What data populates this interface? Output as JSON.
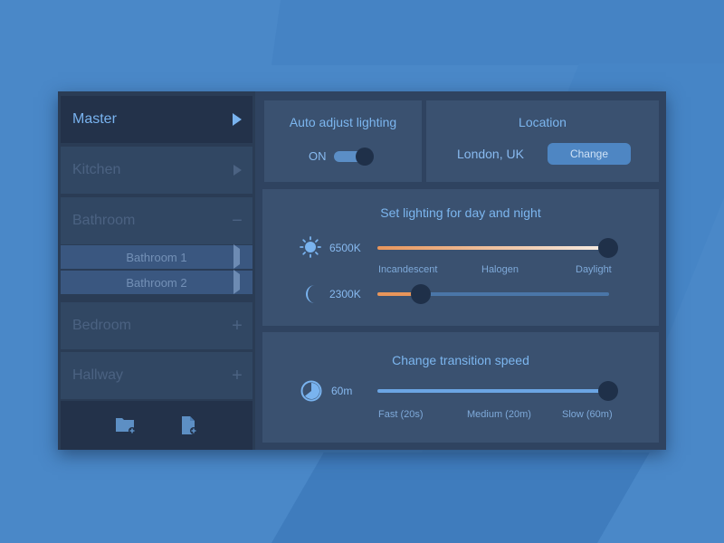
{
  "sidebar": {
    "items": [
      {
        "label": "Master"
      },
      {
        "label": "Kitchen"
      },
      {
        "label": "Bathroom"
      },
      {
        "label": "Bedroom"
      },
      {
        "label": "Hallway"
      }
    ],
    "subitems": [
      {
        "label": "Bathroom 1"
      },
      {
        "label": "Bathroom 2"
      }
    ],
    "footer_icons": [
      "folder-add-icon",
      "file-add-icon"
    ]
  },
  "auto_adjust": {
    "title": "Auto adjust lighting",
    "state_label": "ON",
    "enabled": true
  },
  "location": {
    "title": "Location",
    "value": "London, UK",
    "button_label": "Change"
  },
  "lighting": {
    "title": "Set lighting for day and night",
    "day": {
      "icon": "sun-icon",
      "value_label": "6500K",
      "level": 1.0
    },
    "night": {
      "icon": "moon-icon",
      "value_label": "2300K",
      "level": 0.19
    },
    "scale_labels": [
      "Incandescent",
      "Halogen",
      "Daylight"
    ]
  },
  "transition": {
    "title": "Change transition speed",
    "icon": "clock-icon",
    "value_label": "60m",
    "level": 1.0,
    "scale_labels": [
      "Fast (20s)",
      "Medium (20m)",
      "Slow (60m)"
    ]
  },
  "colors": {
    "accent": "#79b3ef",
    "warm": "#e8955a",
    "knob": "#1f3049"
  }
}
